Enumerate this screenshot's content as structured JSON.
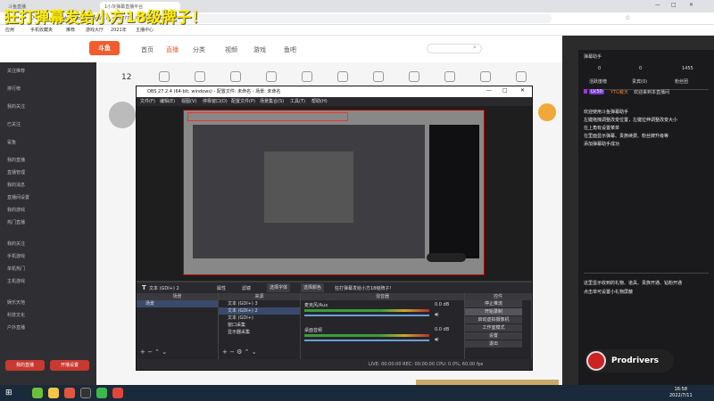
{
  "banner": "狂打弹幕发给小方18级牌子！",
  "browser": {
    "tabs": [
      "斗鱼直播",
      "1小灰弹幕直播平台"
    ],
    "url": "...docs.douyu.com/...?...=257?7... /971086/8123989/...",
    "bookmarks": [
      "应用",
      "手机收藏夹",
      "推荐",
      "游戏大厅",
      "2021年",
      "主播中心"
    ]
  },
  "site": {
    "logo": "斗鱼",
    "nav": [
      "首页",
      "直播",
      "分类",
      "视频",
      "游戏",
      "鱼吧"
    ],
    "counter": "12"
  },
  "sidebar": {
    "items": [
      "关注推荐",
      "排行榜",
      "我的关注",
      "已关注",
      "鲨鱼",
      "我的直播",
      "直播管理",
      "我的消息",
      "直播间设置",
      "我的游戏",
      "热门直播",
      "我的关注",
      "手机游戏",
      "单机热门",
      "主机游戏",
      "娱乐天地",
      "科技文化",
      "户外直播"
    ],
    "button_left": "我的直播",
    "button_right": "开播设置"
  },
  "obs": {
    "title": "OBS 27.2.4 (64-bit, windows) - 配置文件: 未命名 - 场景: 未命名",
    "menu": [
      "文件(F)",
      "编辑(E)",
      "视图(V)",
      "停靠窗口(D)",
      "配置文件(P)",
      "场景集合(S)",
      "工具(T)",
      "帮助(H)"
    ],
    "source_bar": [
      "文本 (GDI+) 2",
      "属性",
      "滤镜",
      "选择字体",
      "选择颜色"
    ],
    "source_bar_text": "狂打弹幕发给小方18级牌子！",
    "panels": {
      "scenes_header": "场景",
      "scene": "场景",
      "sources_header": "来源",
      "sources": [
        "文本 (GDI+) 3",
        "文本 (GDI+) 2",
        "文本 (GDI+)",
        "窗口采集",
        "显示器采集"
      ],
      "mixer_header": "混音器",
      "mixer": [
        {
          "name": "麦克风/Aux",
          "level": "0.0 dB"
        },
        {
          "name": "桌面音频",
          "level": "0.0 dB"
        }
      ],
      "controls_header": "控件",
      "controls": [
        "停止推流",
        "开始录制",
        "启动虚拟摄像机",
        "工作室模式",
        "设置",
        "退出"
      ]
    },
    "status": "LIVE: 00:00:00   REC: 00:00:00   CPU: 0.0%, 60.00 fps"
  },
  "chat": {
    "header": "弹幕助手",
    "stats": [
      "0",
      "0",
      "1455"
    ],
    "tabs": [
      "活跃度榜",
      "贵宾(0)",
      "粉丝团"
    ],
    "level_badge": "LV.50",
    "user": "YTG戴天",
    "welcome": "欢迎来到本直播间",
    "messages": [
      "欢迎使用斗鱼弹幕助手",
      "左键拖拽调整改变位置，左键拉伸调整改变大小",
      "在上角有设置菜单",
      "在里面显示弹幕、贵族续费、粉丝牌升级等",
      "添加弹幕助手成功"
    ],
    "note": [
      "这里显示收到的礼物、道具、贵族开通、钻粉开通",
      "点击单可设置小礼物屏蔽"
    ]
  },
  "watermark": "Prodrivers",
  "taskbar": {
    "time": "16:58",
    "date": "2022/7/11"
  }
}
